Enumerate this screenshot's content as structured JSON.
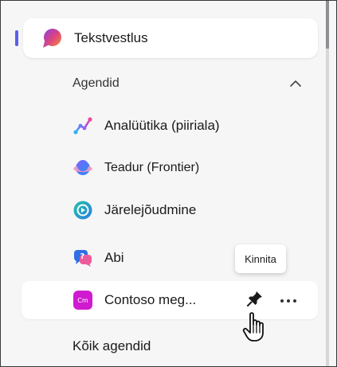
{
  "chat": {
    "label": "Tekstvestlus",
    "icon": "chat-bubble-icon"
  },
  "agents_section": {
    "label": "Agendid",
    "icon": "chevron-up-icon"
  },
  "agents": [
    {
      "label": "Analüütika (piiriala)",
      "icon": "analytics-icon"
    },
    {
      "label": "Teadur (Frontier)",
      "icon": "researcher-icon"
    },
    {
      "label": "Järelejõudmine",
      "icon": "catch-up-icon"
    },
    {
      "label": "Abi",
      "icon": "help-chat-icon"
    },
    {
      "label": "Contoso meg...",
      "icon": "contoso-agent-icon",
      "badge": "Cm"
    }
  ],
  "tooltip": {
    "text": "Kinnita"
  },
  "row_actions": {
    "pin_icon": "pin-icon",
    "more_icon": "more-options-icon"
  },
  "all_agents": {
    "label": "Kõik agendid"
  },
  "colors": {
    "accent": "#5b5fe9",
    "panel_bg": "#f6f6f7",
    "contoso": "#d01ad0"
  }
}
